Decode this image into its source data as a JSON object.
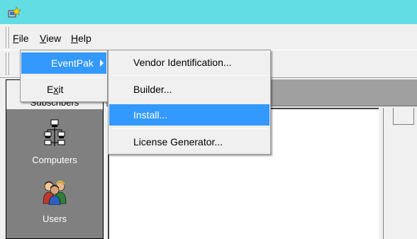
{
  "menubar": {
    "file": {
      "accel": "F",
      "rest": "ile"
    },
    "view": {
      "accel": "V",
      "rest": "iew"
    },
    "help": {
      "accel": "H",
      "rest": "elp"
    }
  },
  "file_menu": {
    "eventpak": "EventPak",
    "exit": {
      "pre": "E",
      "accel": "x",
      "rest": "it"
    }
  },
  "eventpak_submenu": {
    "items": [
      "Vendor Identification...",
      "Builder...",
      "Install...",
      "License Generator..."
    ],
    "highlighted_index": 2
  },
  "nav": {
    "header": "Subscribers",
    "items": [
      {
        "label": "Computers",
        "icon": "computers-network-icon"
      },
      {
        "label": "Users",
        "icon": "users-group-icon"
      }
    ]
  },
  "colors": {
    "titlebar": "#61dde3",
    "highlight": "#3399ff",
    "nav_panel": "#808080"
  }
}
